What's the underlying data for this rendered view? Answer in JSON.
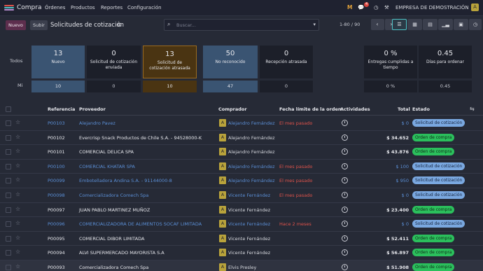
{
  "navbar": {
    "brand": "Compra",
    "menu": [
      "Órdenes",
      "Productos",
      "Reportes",
      "Configuración"
    ],
    "activity_badge": "4",
    "company": "EMPRESA DE DEMOSTRACIÓN",
    "user_initial": "A",
    "logo_letter": "M"
  },
  "control": {
    "new_label": "Nuevo",
    "upload_label": "Subir",
    "title": "Solicitudes de cotización",
    "search_placeholder": "Buscar...",
    "pager": "1-80 / 90"
  },
  "dashboard": {
    "row_all": "Todos",
    "row_me": "Mi",
    "cards": [
      {
        "num": "13",
        "label": "Nuevo",
        "me": "10"
      },
      {
        "num": "0",
        "label": "Solicitud de cotización enviada",
        "me": "0"
      },
      {
        "num": "13",
        "label": "Solicitud de cotización atrasada",
        "me": "10"
      },
      {
        "num": "50",
        "label": "No reconocido",
        "me": "47"
      },
      {
        "num": "0",
        "label": "Recepción atrasada",
        "me": "0"
      }
    ],
    "stats": [
      {
        "num": "0 %",
        "label": "Entregas cumplidas a tiempo",
        "me": "0 %"
      },
      {
        "num": "0.45",
        "label": "Días para ordenar",
        "me": "0.45"
      }
    ]
  },
  "table": {
    "headers": {
      "ref": "Referencia",
      "vendor": "Proveedor",
      "buyer": "Comprador",
      "deadline": "Fecha límite de la orden",
      "activities": "Actividades",
      "total": "Total",
      "status": "Estado"
    },
    "rows": [
      {
        "ref": "P00103",
        "vendor": "Alejandro Pavez",
        "buyer": "Alejandro Fernández",
        "deadline": "El mes pasado",
        "total": "$ 0",
        "status": "Solicitud de cotización",
        "kind": "rfq",
        "hl": false
      },
      {
        "ref": "P00102",
        "vendor": "Evercrisp Snack Productos de Chile S.A. - 94528000-K",
        "buyer": "Alejandro Fernández",
        "deadline": "",
        "total": "$ 34.652",
        "status": "Orden de compra",
        "kind": "po",
        "hl": false
      },
      {
        "ref": "P00101",
        "vendor": "COMERCIAL DELICA SPA",
        "buyer": "Alejandro Fernández",
        "deadline": "",
        "total": "$ 43.876",
        "status": "Orden de compra",
        "kind": "po",
        "hl": false
      },
      {
        "ref": "P00100",
        "vendor": "COMERCIAL KHATAR SPA",
        "buyer": "Alejandro Fernández",
        "deadline": "El mes pasado",
        "total": "$ 100",
        "status": "Solicitud de cotización",
        "kind": "rfq",
        "hl": false
      },
      {
        "ref": "P00099",
        "vendor": "Embotelladora Andina S.A. - 91144000-8",
        "buyer": "Alejandro Fernández",
        "deadline": "El mes pasado",
        "total": "$ 950",
        "status": "Solicitud de cotización",
        "kind": "rfq",
        "hl": false
      },
      {
        "ref": "P00098",
        "vendor": "Comercializadora Comech Spa",
        "buyer": "Vicente Fernández",
        "deadline": "El mes pasado",
        "total": "$ 0",
        "status": "Solicitud de cotización",
        "kind": "rfq",
        "hl": false
      },
      {
        "ref": "P00097",
        "vendor": "JUAN PABLO MARTINEZ MUÑOZ",
        "buyer": "Vicente Fernández",
        "deadline": "",
        "total": "$ 23.400",
        "status": "Orden de compra",
        "kind": "po",
        "hl": false
      },
      {
        "ref": "P00096",
        "vendor": "COMERCIALIZADORA DE ALIMENTOS SOCAF LIMITADA",
        "buyer": "Vicente Fernández",
        "deadline": "Hace 2 meses",
        "total": "$ 0",
        "status": "Solicitud de cotización",
        "kind": "rfq",
        "hl": false
      },
      {
        "ref": "P00095",
        "vendor": "COMERCIAL DIBOR LIMITADA",
        "buyer": "Vicente Fernández",
        "deadline": "",
        "total": "$ 52.411",
        "status": "Orden de compra",
        "kind": "po",
        "hl": false
      },
      {
        "ref": "P00094",
        "vendor": "ALVI SUPERMERCADO MAYORISTA S.A",
        "buyer": "Vicente Fernández",
        "deadline": "",
        "total": "$ 56.897",
        "status": "Orden de compra",
        "kind": "po",
        "hl": false
      },
      {
        "ref": "P00093",
        "vendor": "Comercializadora Comech Spa",
        "buyer": "Elvis Presley",
        "deadline": "",
        "total": "$ 51.908",
        "status": "Orden de compra",
        "kind": "po",
        "hl": true
      }
    ]
  },
  "colors": {
    "accent_new": "#5d2e4d",
    "link": "#5b8fd6",
    "overdue": "#e0534b",
    "rfq_badge": "#7aa8e0",
    "po_badge": "#2bbf5c"
  }
}
